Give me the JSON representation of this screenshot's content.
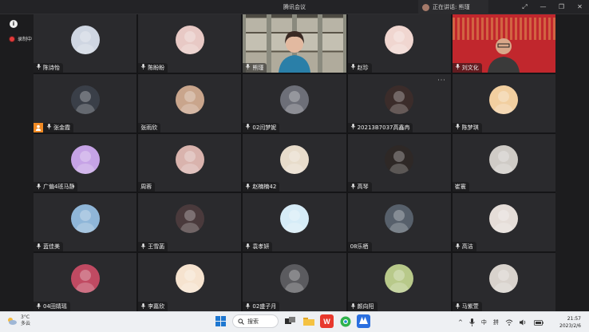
{
  "window": {
    "title": "腾讯会议",
    "speaking_label": "正在讲话: 熊瑾",
    "controls": [
      "pin-icon",
      "minimize-icon",
      "maximize-icon",
      "close-icon"
    ]
  },
  "rail": {
    "info_icon": "info-icon",
    "recording_label": "录制中"
  },
  "participants": [
    {
      "name": "陈诗怡",
      "mic": true,
      "kind": "avatar",
      "color": "#cfd6e2"
    },
    {
      "name": "陈盼盼",
      "mic": true,
      "kind": "avatar",
      "color": "#e8c9c5"
    },
    {
      "name": "熊瑾",
      "mic": true,
      "kind": "video-room"
    },
    {
      "name": "赵珍",
      "mic": true,
      "kind": "avatar",
      "color": "#f0d6d0"
    },
    {
      "name": "刘文化",
      "mic": true,
      "kind": "video-banner"
    },
    {
      "name": "张金霞",
      "mic": true,
      "kind": "avatar",
      "color": "#3a3f48",
      "host": true
    },
    {
      "name": "张雨欣",
      "mic": false,
      "kind": "avatar",
      "color": "#c9a58c"
    },
    {
      "name": "02闫梦妮",
      "mic": true,
      "kind": "avatar",
      "color": "#6d6f78"
    },
    {
      "name": "20213B7037高鑫冉",
      "mic": true,
      "kind": "avatar",
      "color": "#3b2c2a",
      "more": true
    },
    {
      "name": "陈梦琪",
      "mic": true,
      "kind": "avatar",
      "color": "#f2cfa0"
    },
    {
      "name": "广偏4班马静",
      "mic": true,
      "kind": "avatar",
      "color": "#c6a3e6"
    },
    {
      "name": "周蓉",
      "mic": false,
      "kind": "avatar",
      "color": "#d9b3ad"
    },
    {
      "name": "赵楠楠42",
      "mic": true,
      "kind": "avatar",
      "color": "#e8dccb"
    },
    {
      "name": "高琴",
      "mic": true,
      "kind": "avatar",
      "color": "#2e2826"
    },
    {
      "name": "崔寰",
      "mic": false,
      "kind": "avatar",
      "color": "#cfcbc6"
    },
    {
      "name": "蓝佳美",
      "mic": true,
      "kind": "avatar",
      "color": "#8fb6d8"
    },
    {
      "name": "王雪菡",
      "mic": true,
      "kind": "avatar",
      "color": "#4a3a3c"
    },
    {
      "name": "袁孝妍",
      "mic": true,
      "kind": "avatar",
      "color": "#d6ecf7"
    },
    {
      "name": "08乐栖",
      "mic": false,
      "kind": "avatar",
      "color": "#57606b"
    },
    {
      "name": "高洁",
      "mic": true,
      "kind": "avatar",
      "color": "#e5ddd8"
    },
    {
      "name": "04田婧瑶",
      "mic": true,
      "kind": "avatar",
      "color": "#c04a62"
    },
    {
      "name": "李嘉欣",
      "mic": true,
      "kind": "avatar",
      "color": "#f6e3cf"
    },
    {
      "name": "02盛子月",
      "mic": true,
      "kind": "avatar",
      "color": "#5b5b5f"
    },
    {
      "name": "颜向阳",
      "mic": true,
      "kind": "avatar",
      "color": "#b8c98a"
    },
    {
      "name": "马紫萱",
      "mic": true,
      "kind": "avatar",
      "color": "#d8d2cc"
    }
  ],
  "taskbar": {
    "weather_temp": "3°C",
    "weather_desc": "多云",
    "search_label": "搜索",
    "apps": [
      "windows-start-icon",
      "search-icon",
      "task-view-icon",
      "file-explorer-icon",
      "wps-icon",
      "browser-icon",
      "tencent-meeting-icon"
    ],
    "tray": {
      "chevron": "^",
      "ime": "中",
      "ime2": "拼"
    },
    "time": "21:57",
    "date": "2023/2/6"
  }
}
